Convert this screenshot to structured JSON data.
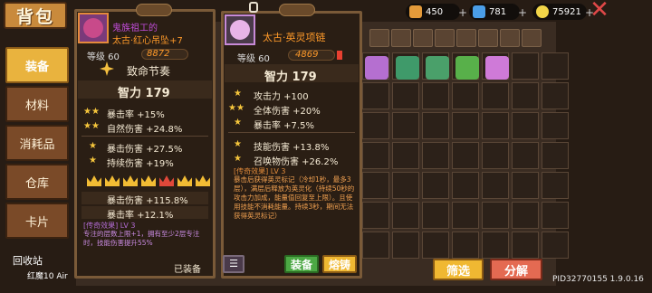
{
  "header": {
    "title": "背包"
  },
  "resources": [
    {
      "icon": "coin-icon",
      "value": "450",
      "color": "#e39a3a"
    },
    {
      "icon": "gem-icon",
      "value": "781",
      "color": "#4a9ee8"
    },
    {
      "icon": "gold-icon",
      "value": "75921",
      "color": "#f2d548"
    }
  ],
  "tabs": [
    {
      "label": "装备",
      "active": true
    },
    {
      "label": "材料",
      "active": false
    },
    {
      "label": "消耗品",
      "active": false
    },
    {
      "label": "仓库",
      "active": false
    },
    {
      "label": "卡片",
      "active": false
    }
  ],
  "left_card": {
    "name_line1": "鬼族祖工的",
    "name_line2": "太古·红心吊坠+7",
    "level": "等级 60",
    "power": "8872",
    "effect_title": "致命节奏",
    "main_stat": "智力 179",
    "stats_a": [
      {
        "stars": "★★",
        "text": "暴击率 +15%"
      },
      {
        "stars": "★★",
        "text": "自然伤害 +24.8%"
      }
    ],
    "stats_b": [
      {
        "stars": "★",
        "text": "暴击伤害 +27.5%"
      },
      {
        "stars": "★",
        "text": "持续伤害 +19%"
      }
    ],
    "crown_stats": [
      {
        "text": "暴击伤害 +115.8%"
      },
      {
        "text": "暴击率 +12.1%"
      }
    ],
    "legend_title": "[传奇效果] LV 3",
    "legend_desc": "专注的层数上限+1，拥有至少2层专注时，技能伤害提升55%",
    "equipped": "已装备"
  },
  "right_card": {
    "name": "太古·英灵项链",
    "level": "等级 60",
    "power": "4869",
    "main_stat": "智力 179",
    "stats_a": [
      {
        "stars": "★",
        "text": "攻击力 +100"
      },
      {
        "stars": "★★",
        "text": "全体伤害 +20%"
      },
      {
        "stars": "★",
        "text": "暴击率 +7.5%"
      }
    ],
    "stats_b": [
      {
        "stars": "★",
        "text": "技能伤害 +13.8%"
      },
      {
        "stars": "★",
        "text": "召唤物伤害 +26.2%"
      }
    ],
    "legend_title": "[传奇效果] LV 3",
    "legend_desc": "暴击后获得英灵标记（冷却1秒，最多3层），满层后释放为英灵化（持续50秒的攻击力加成，能量值回复至上限）。且使用技能不消耗能量。持续3秒，期间无法获得英灵标记）",
    "equip_btn": "装备",
    "smelt_btn": "熔铸"
  },
  "footer": {
    "filter_btn": "筛选",
    "decompose_btn": "分解",
    "recycle": "回收站",
    "version": "PID32770155 1.9.0.16"
  },
  "device_label": "红魔10 Air"
}
